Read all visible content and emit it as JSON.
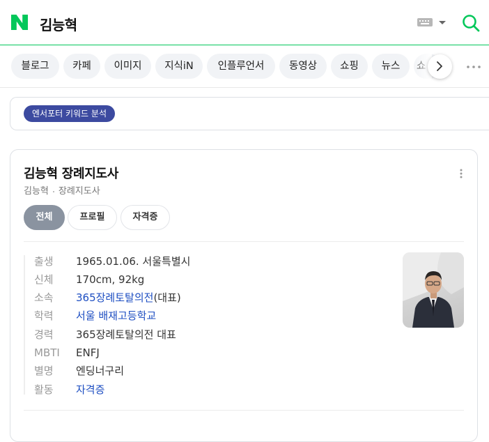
{
  "header": {
    "query": "김능혁",
    "logo": "naver-n-logo",
    "icons": [
      "keyboard-icon",
      "caret-down-icon",
      "search-icon"
    ],
    "brand_color": "#03c75a"
  },
  "tabs": {
    "items": [
      {
        "label": "블로그"
      },
      {
        "label": "카페"
      },
      {
        "label": "이미지"
      },
      {
        "label": "지식iN"
      },
      {
        "label": "인플루언서"
      },
      {
        "label": "동영상"
      },
      {
        "label": "쇼핑"
      },
      {
        "label": "뉴스"
      },
      {
        "label": "쇼"
      }
    ]
  },
  "keyword": {
    "pill_label": "엔서포터 키워드 분석",
    "pill_color": "#3c4aa0"
  },
  "profile": {
    "title": "김능혁 장례지도사",
    "sub_name": "김능혁",
    "sub_role": "장례지도사",
    "tabs": [
      {
        "label": "전체",
        "active": true
      },
      {
        "label": "프로필",
        "active": false
      },
      {
        "label": "자격증",
        "active": false
      }
    ],
    "rows": [
      {
        "label": "출생",
        "value": "1965.01.06. 서울특별시",
        "link": ""
      },
      {
        "label": "신체",
        "value": "170cm, 92kg",
        "link": ""
      },
      {
        "label": "소속",
        "link": "365장례토탈의전",
        "value": "(대표)"
      },
      {
        "label": "학력",
        "link": "서울 배재고등학교",
        "value": ""
      },
      {
        "label": "경력",
        "value": "365장례토탈의전 대표",
        "link": ""
      },
      {
        "label": "MBTI",
        "value": "ENFJ",
        "link": ""
      },
      {
        "label": "별명",
        "value": "엔딩너구리",
        "link": ""
      },
      {
        "label": "활동",
        "link": "자격증",
        "value": ""
      }
    ],
    "link_color": "#1d4ec2"
  }
}
